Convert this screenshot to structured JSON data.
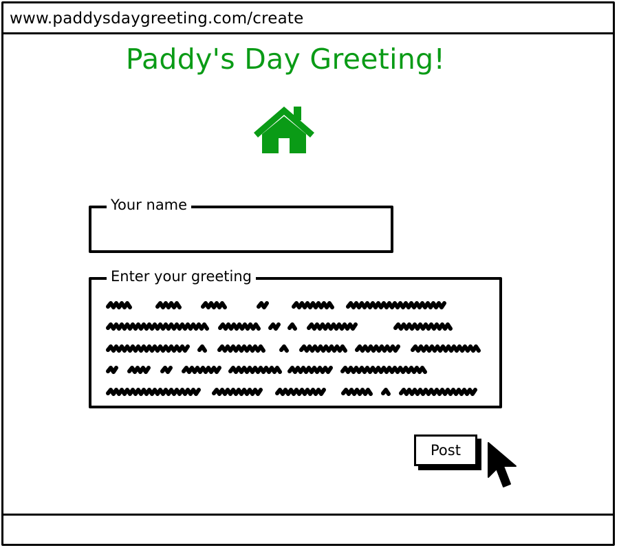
{
  "browser": {
    "url": "www.paddysdaygreeting.com/create"
  },
  "page": {
    "title": "Paddy's Day Greeting!",
    "home_icon": "home-icon"
  },
  "form": {
    "name_label": "Your name",
    "name_value": "",
    "greeting_label": "Enter your greeting",
    "greeting_lines": 5,
    "post_label": "Post"
  },
  "colors": {
    "accent": "#0a9b16",
    "ink": "#000000",
    "background": "#ffffff"
  },
  "icons": {
    "home": "home-icon",
    "cursor": "mouse-pointer-icon"
  }
}
